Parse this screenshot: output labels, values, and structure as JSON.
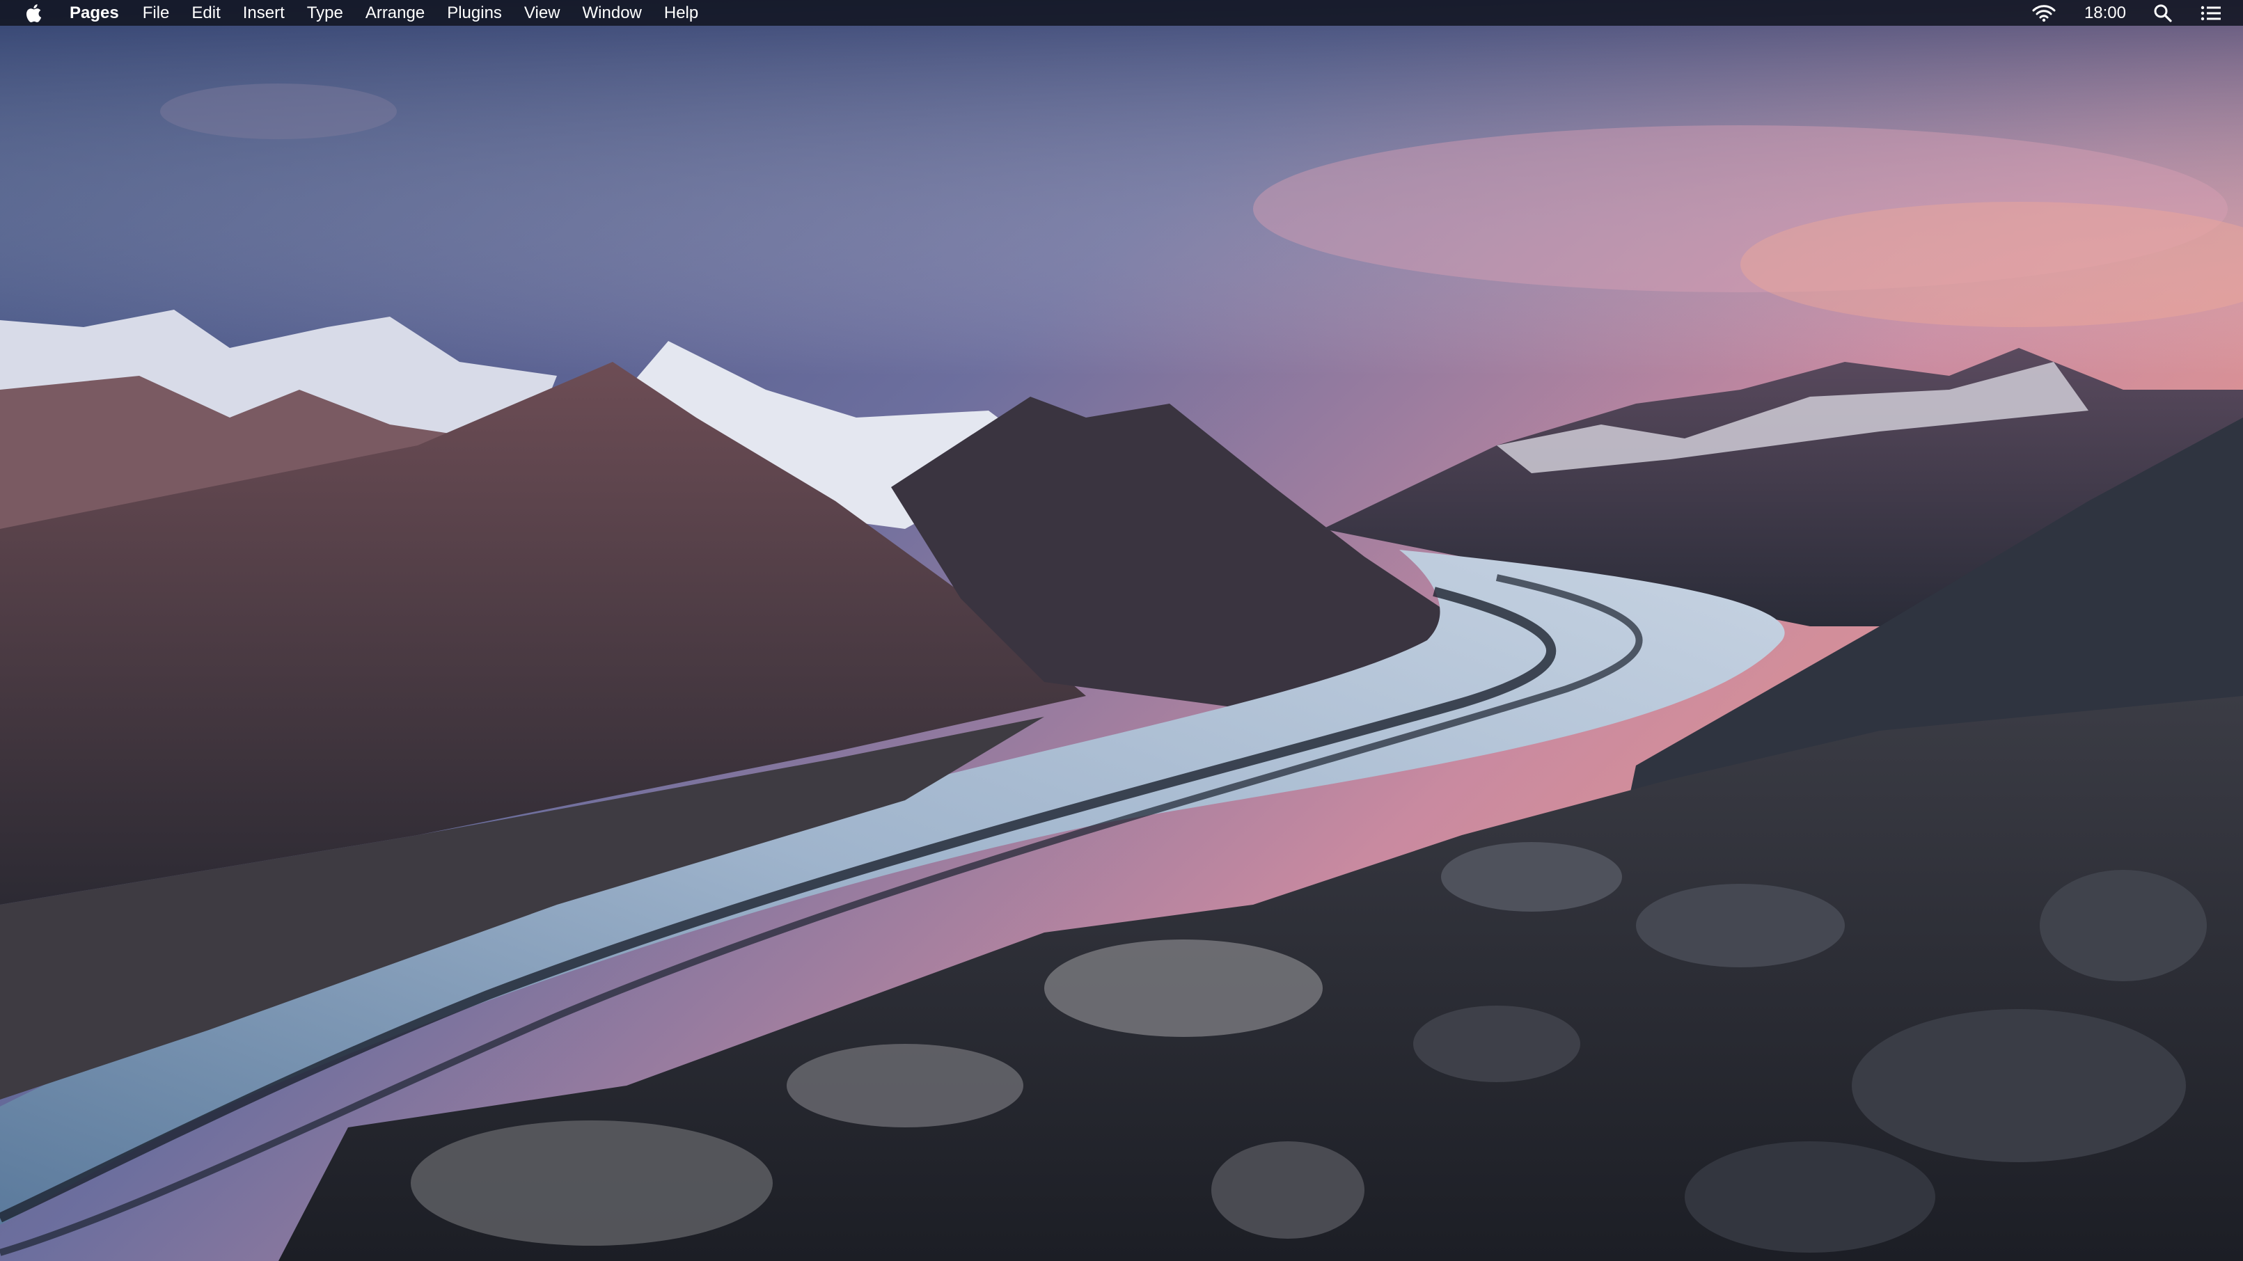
{
  "menubar": {
    "app_name": "Pages",
    "menus": [
      "File",
      "Edit",
      "Insert",
      "Type",
      "Arrange",
      "Plugins",
      "View",
      "Window",
      "Help"
    ],
    "clock": "18:00"
  },
  "icons": {
    "apple": "apple-logo-icon",
    "wifi": "wifi-icon",
    "search": "spotlight-search-icon",
    "notifications": "notification-center-icon"
  },
  "colors": {
    "menubar_bg": "#121622",
    "sky_top": "#3f4f7c",
    "sunset_pink": "#e0889a",
    "glacier_ice": "#9fb4cc",
    "rock_dark": "#2a2d35"
  }
}
